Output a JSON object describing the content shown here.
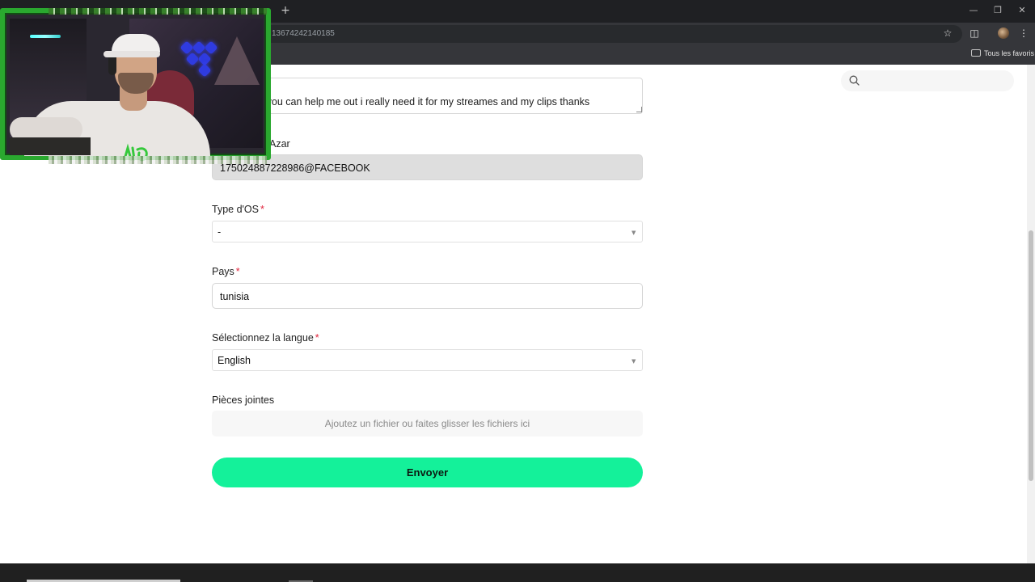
{
  "browser": {
    "url": "13674242140185",
    "bookmarks_folder_label": "Tous les favoris",
    "new_tab_glyph": "+",
    "icons": [
      "star-icon",
      "extensions-icon",
      "menu-icon",
      "minimize-icon",
      "restore-icon",
      "close-icon",
      "folder-icon",
      "search-icon"
    ]
  },
  "form": {
    "description_text": "preciate if you can help me out i really need it for my streames and my clips thanks",
    "azar_label_partial": "Azar",
    "azar_id_value": "175024887228986@FACEBOOK",
    "os_label": "Type d'OS",
    "os_value": "-",
    "country_label": "Pays",
    "country_value": "tunisia",
    "language_label": "Sélectionnez la langue",
    "language_value": "English",
    "attachments_label": "Pièces jointes",
    "dropzone_text": "Ajoutez un fichier ou faites glisser les fichiers ici",
    "submit_label": "Envoyer",
    "required_mark": "*"
  },
  "colors": {
    "accent": "#14f19a",
    "required": "#e0243c",
    "cam_frame": "#2aa82f"
  }
}
